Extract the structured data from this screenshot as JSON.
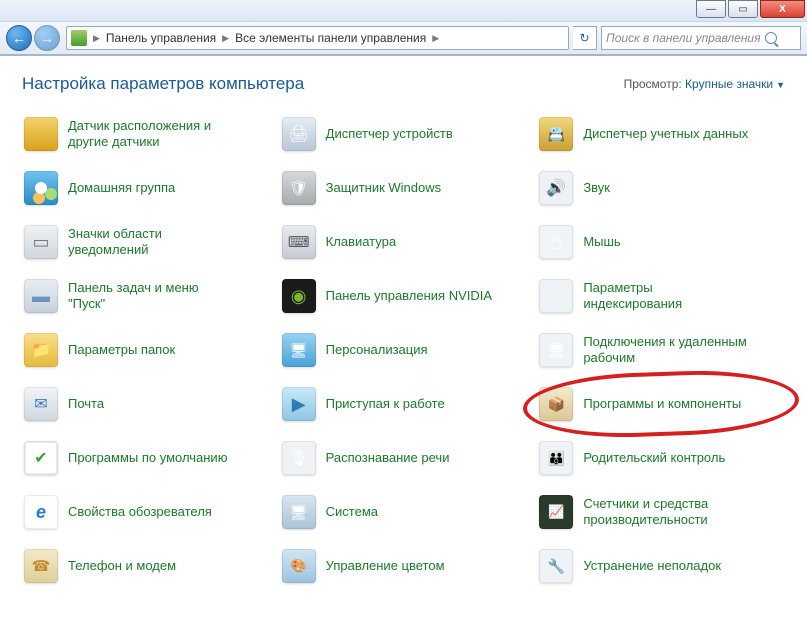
{
  "titlebar": {
    "min": "—",
    "max": "▭",
    "close": "X"
  },
  "nav": {
    "breadcrumb": [
      "Панель управления",
      "Все элементы панели управления"
    ],
    "search_placeholder": "Поиск в панели управления"
  },
  "header": {
    "title": "Настройка параметров компьютера",
    "view_label": "Просмотр:",
    "view_value": "Крупные значки"
  },
  "items": [
    {
      "label": "Датчик расположения и другие датчики",
      "icon": "ic-sensor"
    },
    {
      "label": "Диспетчер устройств",
      "icon": "ic-device"
    },
    {
      "label": "Диспетчер учетных данных",
      "icon": "ic-cred"
    },
    {
      "label": "Домашняя группа",
      "icon": "ic-home"
    },
    {
      "label": "Защитник Windows",
      "icon": "ic-def"
    },
    {
      "label": "Звук",
      "icon": "ic-sound"
    },
    {
      "label": "Значки области уведомлений",
      "icon": "ic-notify"
    },
    {
      "label": "Клавиатура",
      "icon": "ic-keyb"
    },
    {
      "label": "Мышь",
      "icon": "ic-mouse"
    },
    {
      "label": "Панель задач и меню \"Пуск\"",
      "icon": "ic-task"
    },
    {
      "label": "Панель управления NVIDIA",
      "icon": "ic-nvidia"
    },
    {
      "label": "Параметры индексирования",
      "icon": "ic-index"
    },
    {
      "label": "Параметры папок",
      "icon": "ic-folder"
    },
    {
      "label": "Персонализация",
      "icon": "ic-personal"
    },
    {
      "label": "Подключения к удаленным рабочим",
      "icon": "ic-rdp"
    },
    {
      "label": "Почта",
      "icon": "ic-mail"
    },
    {
      "label": "Приступая к работе",
      "icon": "ic-start"
    },
    {
      "label": "Программы и компоненты",
      "icon": "ic-prog",
      "circled": true
    },
    {
      "label": "Программы по умолчанию",
      "icon": "ic-default"
    },
    {
      "label": "Распознавание речи",
      "icon": "ic-speech"
    },
    {
      "label": "Родительский контроль",
      "icon": "ic-parent"
    },
    {
      "label": "Свойства обозревателя",
      "icon": "ic-ie"
    },
    {
      "label": "Система",
      "icon": "ic-sys"
    },
    {
      "label": "Счетчики и средства производительности",
      "icon": "ic-perf"
    },
    {
      "label": "Телефон и модем",
      "icon": "ic-phone"
    },
    {
      "label": "Управление цветом",
      "icon": "ic-color"
    },
    {
      "label": "Устранение неполадок",
      "icon": "ic-trouble"
    }
  ]
}
